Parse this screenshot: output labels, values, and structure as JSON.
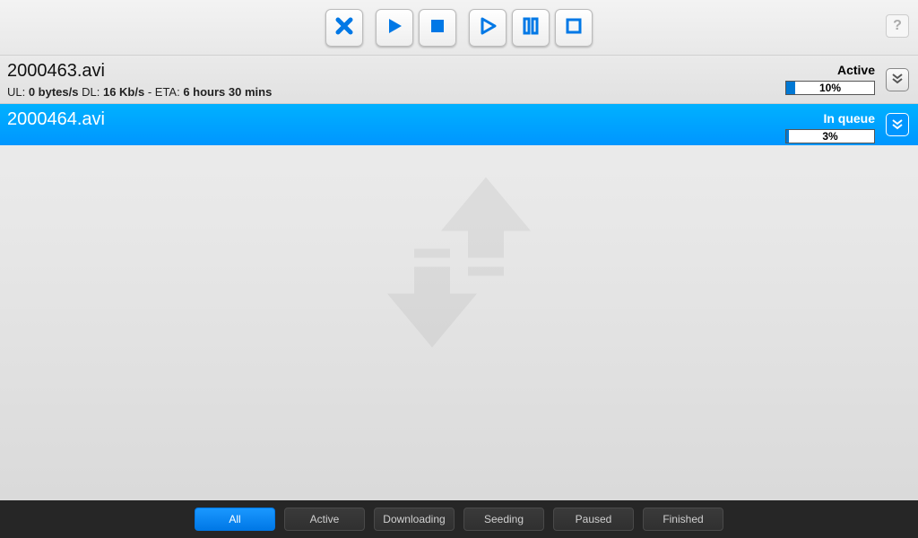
{
  "toolbar": {
    "close_label": "Close",
    "play_label": "Start",
    "stop_label": "Stop",
    "play_all_label": "Start All",
    "pause_all_label": "Pause All",
    "stop_all_label": "Stop All",
    "help_label": "?"
  },
  "torrents": [
    {
      "filename": "2000463.avi",
      "status": "Active",
      "progress_pct": "10%",
      "progress_value": 10,
      "ul_label": "UL: ",
      "ul_value": "0 bytes/s",
      "dl_label": " DL: ",
      "dl_value": "16 Kb/s",
      "eta_label": " - ETA: ",
      "eta_value": "6 hours 30 mins"
    },
    {
      "filename": "2000464.avi",
      "status": "In queue",
      "progress_pct": "3%",
      "progress_value": 3
    }
  ],
  "filters": {
    "all": "All",
    "active": "Active",
    "downloading": "Downloading",
    "seeding": "Seeding",
    "paused": "Paused",
    "finished": "Finished"
  },
  "colors": {
    "accent": "#0096ff",
    "progress_fill": "#0078d4"
  }
}
